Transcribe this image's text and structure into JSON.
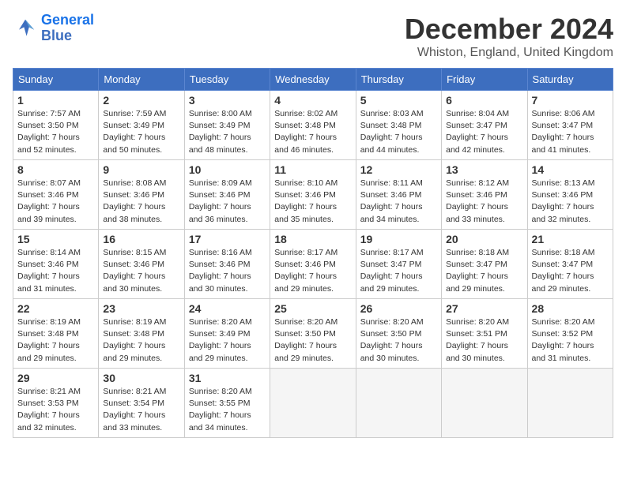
{
  "header": {
    "logo_line1": "General",
    "logo_line2": "Blue",
    "month_title": "December 2024",
    "location": "Whiston, England, United Kingdom"
  },
  "weekdays": [
    "Sunday",
    "Monday",
    "Tuesday",
    "Wednesday",
    "Thursday",
    "Friday",
    "Saturday"
  ],
  "weeks": [
    [
      {
        "day": "1",
        "sunrise": "Sunrise: 7:57 AM",
        "sunset": "Sunset: 3:50 PM",
        "daylight": "Daylight: 7 hours and 52 minutes."
      },
      {
        "day": "2",
        "sunrise": "Sunrise: 7:59 AM",
        "sunset": "Sunset: 3:49 PM",
        "daylight": "Daylight: 7 hours and 50 minutes."
      },
      {
        "day": "3",
        "sunrise": "Sunrise: 8:00 AM",
        "sunset": "Sunset: 3:49 PM",
        "daylight": "Daylight: 7 hours and 48 minutes."
      },
      {
        "day": "4",
        "sunrise": "Sunrise: 8:02 AM",
        "sunset": "Sunset: 3:48 PM",
        "daylight": "Daylight: 7 hours and 46 minutes."
      },
      {
        "day": "5",
        "sunrise": "Sunrise: 8:03 AM",
        "sunset": "Sunset: 3:48 PM",
        "daylight": "Daylight: 7 hours and 44 minutes."
      },
      {
        "day": "6",
        "sunrise": "Sunrise: 8:04 AM",
        "sunset": "Sunset: 3:47 PM",
        "daylight": "Daylight: 7 hours and 42 minutes."
      },
      {
        "day": "7",
        "sunrise": "Sunrise: 8:06 AM",
        "sunset": "Sunset: 3:47 PM",
        "daylight": "Daylight: 7 hours and 41 minutes."
      }
    ],
    [
      {
        "day": "8",
        "sunrise": "Sunrise: 8:07 AM",
        "sunset": "Sunset: 3:46 PM",
        "daylight": "Daylight: 7 hours and 39 minutes."
      },
      {
        "day": "9",
        "sunrise": "Sunrise: 8:08 AM",
        "sunset": "Sunset: 3:46 PM",
        "daylight": "Daylight: 7 hours and 38 minutes."
      },
      {
        "day": "10",
        "sunrise": "Sunrise: 8:09 AM",
        "sunset": "Sunset: 3:46 PM",
        "daylight": "Daylight: 7 hours and 36 minutes."
      },
      {
        "day": "11",
        "sunrise": "Sunrise: 8:10 AM",
        "sunset": "Sunset: 3:46 PM",
        "daylight": "Daylight: 7 hours and 35 minutes."
      },
      {
        "day": "12",
        "sunrise": "Sunrise: 8:11 AM",
        "sunset": "Sunset: 3:46 PM",
        "daylight": "Daylight: 7 hours and 34 minutes."
      },
      {
        "day": "13",
        "sunrise": "Sunrise: 8:12 AM",
        "sunset": "Sunset: 3:46 PM",
        "daylight": "Daylight: 7 hours and 33 minutes."
      },
      {
        "day": "14",
        "sunrise": "Sunrise: 8:13 AM",
        "sunset": "Sunset: 3:46 PM",
        "daylight": "Daylight: 7 hours and 32 minutes."
      }
    ],
    [
      {
        "day": "15",
        "sunrise": "Sunrise: 8:14 AM",
        "sunset": "Sunset: 3:46 PM",
        "daylight": "Daylight: 7 hours and 31 minutes."
      },
      {
        "day": "16",
        "sunrise": "Sunrise: 8:15 AM",
        "sunset": "Sunset: 3:46 PM",
        "daylight": "Daylight: 7 hours and 30 minutes."
      },
      {
        "day": "17",
        "sunrise": "Sunrise: 8:16 AM",
        "sunset": "Sunset: 3:46 PM",
        "daylight": "Daylight: 7 hours and 30 minutes."
      },
      {
        "day": "18",
        "sunrise": "Sunrise: 8:17 AM",
        "sunset": "Sunset: 3:46 PM",
        "daylight": "Daylight: 7 hours and 29 minutes."
      },
      {
        "day": "19",
        "sunrise": "Sunrise: 8:17 AM",
        "sunset": "Sunset: 3:47 PM",
        "daylight": "Daylight: 7 hours and 29 minutes."
      },
      {
        "day": "20",
        "sunrise": "Sunrise: 8:18 AM",
        "sunset": "Sunset: 3:47 PM",
        "daylight": "Daylight: 7 hours and 29 minutes."
      },
      {
        "day": "21",
        "sunrise": "Sunrise: 8:18 AM",
        "sunset": "Sunset: 3:47 PM",
        "daylight": "Daylight: 7 hours and 29 minutes."
      }
    ],
    [
      {
        "day": "22",
        "sunrise": "Sunrise: 8:19 AM",
        "sunset": "Sunset: 3:48 PM",
        "daylight": "Daylight: 7 hours and 29 minutes."
      },
      {
        "day": "23",
        "sunrise": "Sunrise: 8:19 AM",
        "sunset": "Sunset: 3:48 PM",
        "daylight": "Daylight: 7 hours and 29 minutes."
      },
      {
        "day": "24",
        "sunrise": "Sunrise: 8:20 AM",
        "sunset": "Sunset: 3:49 PM",
        "daylight": "Daylight: 7 hours and 29 minutes."
      },
      {
        "day": "25",
        "sunrise": "Sunrise: 8:20 AM",
        "sunset": "Sunset: 3:50 PM",
        "daylight": "Daylight: 7 hours and 29 minutes."
      },
      {
        "day": "26",
        "sunrise": "Sunrise: 8:20 AM",
        "sunset": "Sunset: 3:50 PM",
        "daylight": "Daylight: 7 hours and 30 minutes."
      },
      {
        "day": "27",
        "sunrise": "Sunrise: 8:20 AM",
        "sunset": "Sunset: 3:51 PM",
        "daylight": "Daylight: 7 hours and 30 minutes."
      },
      {
        "day": "28",
        "sunrise": "Sunrise: 8:20 AM",
        "sunset": "Sunset: 3:52 PM",
        "daylight": "Daylight: 7 hours and 31 minutes."
      }
    ],
    [
      {
        "day": "29",
        "sunrise": "Sunrise: 8:21 AM",
        "sunset": "Sunset: 3:53 PM",
        "daylight": "Daylight: 7 hours and 32 minutes."
      },
      {
        "day": "30",
        "sunrise": "Sunrise: 8:21 AM",
        "sunset": "Sunset: 3:54 PM",
        "daylight": "Daylight: 7 hours and 33 minutes."
      },
      {
        "day": "31",
        "sunrise": "Sunrise: 8:20 AM",
        "sunset": "Sunset: 3:55 PM",
        "daylight": "Daylight: 7 hours and 34 minutes."
      },
      null,
      null,
      null,
      null
    ]
  ]
}
